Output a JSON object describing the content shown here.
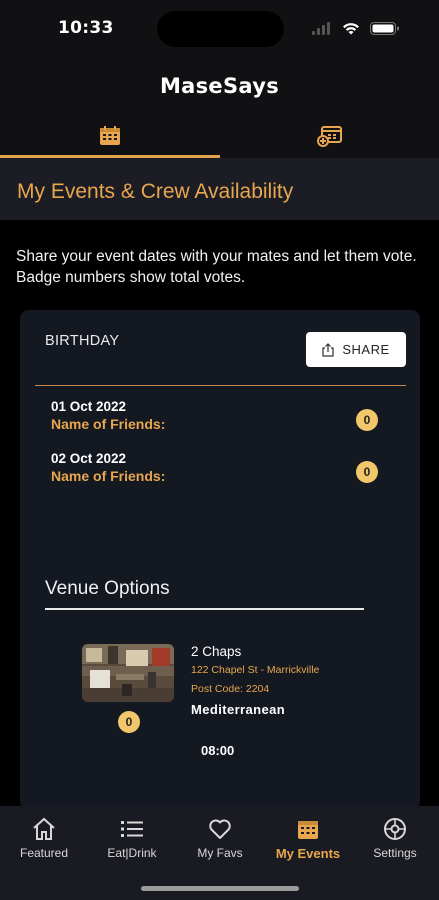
{
  "status_bar": {
    "time": "10:33"
  },
  "app": {
    "title": "MaseSays"
  },
  "top_tabs": [
    {
      "icon": "calendar-icon",
      "active": true
    },
    {
      "icon": "calendar-add-icon",
      "active": false
    }
  ],
  "section": {
    "title": "My Events & Crew Availability"
  },
  "intro": "Share your event dates with your mates and let them vote. Badge numbers show total votes.",
  "event": {
    "name": "BIRTHDAY",
    "share_label": "SHARE",
    "dates": [
      {
        "date": "01 Oct 2022",
        "friends_label": "Name of Friends:",
        "votes": "0"
      },
      {
        "date": "02 Oct 2022",
        "friends_label": "Name of Friends:",
        "votes": "0"
      }
    ],
    "venue_title": "Venue Options",
    "venue": {
      "name": "2 Chaps",
      "address": "122 Chapel St - Marrickville",
      "postcode": "Post Code: 2204",
      "cuisine": "Mediterranean",
      "votes": "0",
      "time": "08:00"
    }
  },
  "bottom_nav": [
    {
      "label": "Featured",
      "icon": "home-icon",
      "active": false
    },
    {
      "label": "Eat|Drink",
      "icon": "list-icon",
      "active": false
    },
    {
      "label": "My Favs",
      "icon": "heart-icon",
      "active": false
    },
    {
      "label": "My Events",
      "icon": "calendar-icon",
      "active": true
    },
    {
      "label": "Settings",
      "icon": "gear-icon",
      "active": false
    }
  ],
  "colors": {
    "accent": "#e8a64e",
    "badge": "#f2c66a",
    "card": "#141821",
    "nav": "#1a1b22"
  }
}
